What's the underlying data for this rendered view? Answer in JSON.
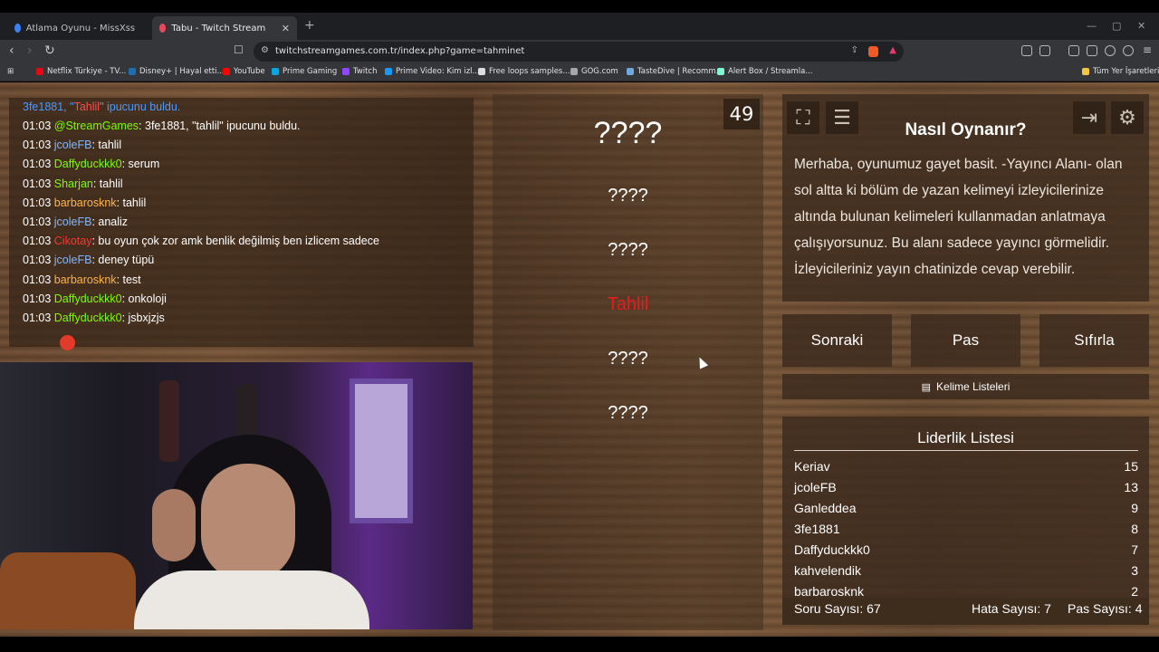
{
  "browser": {
    "tabs": [
      {
        "label": "Atlama Oyunu - MissXss AI Bot Syste",
        "active": false
      },
      {
        "label": "Tabu - Twitch Stream Games",
        "active": true
      }
    ],
    "url": "twitchstreamgames.com.tr/index.php?game=tahminet",
    "bookmarks": [
      "Netflix Türkiye - TV...",
      "Disney+ | Hayal etti...",
      "YouTube",
      "Prime Gaming",
      "Twitch",
      "Prime Video: Kim izl...",
      "Free loops samples...",
      "GOG.com",
      "TasteDive | Recomm...",
      "Alert Box / Streamla...",
      "Tüm Yer İşaretleri"
    ]
  },
  "chat": {
    "top_prefix": "3fe1881, \"",
    "top_word": "Tahlil",
    "top_suffix": "\" ipucunu buldu.",
    "messages": [
      {
        "time": "01:03",
        "user": "@StreamGames",
        "color": "#7CFC00",
        "text": ": 3fe1881, \"tahlil\" ipucunu buldu."
      },
      {
        "time": "01:03",
        "user": "jcoleFB",
        "color": "#7fb7ff",
        "text": ": tahlil"
      },
      {
        "time": "01:03",
        "user": "Daffyduckkk0",
        "color": "#7CFC00",
        "text": ": serum"
      },
      {
        "time": "01:03",
        "user": "Sharjan",
        "color": "#7CFC00",
        "text": ": tahlil"
      },
      {
        "time": "01:03",
        "user": "barbarosknk",
        "color": "#ffb347",
        "text": ": tahlil"
      },
      {
        "time": "01:03",
        "user": "jcoleFB",
        "color": "#7fb7ff",
        "text": ": analiz"
      },
      {
        "time": "01:03",
        "user": "Cikotay",
        "color": "#ff3030",
        "text": ": bu oyun çok zor amk benlik değilmiş ben izlicem sadece"
      },
      {
        "time": "01:03",
        "user": "jcoleFB",
        "color": "#7fb7ff",
        "text": ": deney tüpü"
      },
      {
        "time": "01:03",
        "user": "barbarosknk",
        "color": "#ffb347",
        "text": ": test"
      },
      {
        "time": "01:03",
        "user": "Daffyduckkk0",
        "color": "#7CFC00",
        "text": ": onkoloji"
      },
      {
        "time": "01:03",
        "user": "Daffyduckkk0",
        "color": "#7CFC00",
        "text": ": jsbxjzjs"
      }
    ]
  },
  "game": {
    "counter": "49",
    "words": [
      "????",
      "????",
      "????",
      "Tahlil",
      "????",
      "????"
    ],
    "highlight_color": "#e81c1c"
  },
  "howto": {
    "title": "Nasıl Oynanır?",
    "text": "Merhaba, oyunumuz gayet basit. -Yayıncı Alanı- olan sol altta ki bölüm de yazan kelimeyi izleyicilerinize altında bulunan kelimeleri kullanmadan anlatmaya çalışıyorsunuz. Bu alanı sadece yayıncı görmelidir. İzleyicileriniz yayın chatinizde cevap verebilir."
  },
  "buttons": {
    "next": "Sonraki",
    "pass": "Pas",
    "reset": "Sıfırla",
    "word_lists": "Kelime Listeleri"
  },
  "leaderboard": {
    "title": "Liderlik Listesi",
    "rows": [
      {
        "name": "Keriav",
        "score": "15"
      },
      {
        "name": "jcoleFB",
        "score": "13"
      },
      {
        "name": "Ganleddea",
        "score": "9"
      },
      {
        "name": "3fe1881",
        "score": "8"
      },
      {
        "name": "Daffyduckkk0",
        "score": "7"
      },
      {
        "name": "kahvelendik",
        "score": "3"
      },
      {
        "name": "barbarosknk",
        "score": "2"
      }
    ]
  },
  "stats": {
    "questions": "Soru Sayısı: 67",
    "errors": "Hata Sayısı: 7",
    "passes": "Pas Sayısı: 4"
  }
}
